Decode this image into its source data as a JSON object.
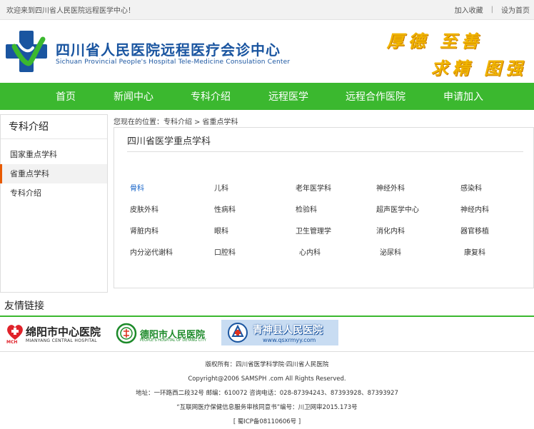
{
  "topbar": {
    "welcome": "欢迎来到四川省人民医院远程医学中心！",
    "favorite": "加入收藏",
    "separator": "|",
    "homepage": "设为首页"
  },
  "header": {
    "title_cn": "四川省人民医院远程医疗会诊中心",
    "title_en": "Sichuan Provincial People's Hospital Tele-Medicine Consulation Center",
    "slogan_line1": "厚德 至善",
    "slogan_line2": "求精 图强",
    "colors": {
      "brand_blue": "#1a55a0",
      "brand_green": "#3bb82f",
      "slogan_gold": "#f0b400"
    }
  },
  "nav": {
    "items": [
      "首页",
      "新闻中心",
      "专科介绍",
      "远程医学",
      "远程合作医院",
      "申请加入"
    ]
  },
  "sidebar": {
    "title": "专科介绍",
    "items": [
      "国家重点学科",
      "省重点学科",
      "专科介绍"
    ],
    "active_index": 1
  },
  "breadcrumb": {
    "prefix": "您现在的位置：",
    "level1": "专科介绍",
    "arrow": ">",
    "level2": "省重点学科"
  },
  "panel": {
    "title": "四川省医学重点学科",
    "departments": [
      [
        "骨科",
        "儿科",
        "老年医学科",
        "神经外科",
        "感染科"
      ],
      [
        "皮肤外科",
        "性病科",
        "检验科",
        "超声医学中心",
        "神经内科"
      ],
      [
        "肾脏内科",
        "眼科",
        "卫生管理学",
        "消化内科",
        "器官移植"
      ],
      [
        "内分泌代谢科",
        "口腔科",
        "心内科",
        "泌尿科",
        "康复科"
      ]
    ],
    "active_department": "骨科"
  },
  "friends": {
    "label": "友情链接",
    "links": [
      {
        "name": "绵阳市中心医院",
        "sub": "MIANYANG CENTRAL HOSPITAL",
        "mark": "MCH"
      },
      {
        "name": "德阳市人民医院",
        "sub": "PEOPLE'S HOSPITAL OF DEYANG CITY"
      },
      {
        "name": "青神县人民医院",
        "sub": "www.qsxrmyy.com"
      }
    ]
  },
  "footer": {
    "lines": [
      "版权所有：四川省医学科学院·四川省人民医院",
      "Copyright@2006 SAMSPH .com All Rights Reserved.",
      "地址：一环路西二段32号 邮编：610072 咨询电话：028-87394243、87393928、87393927",
      "“互联网医疗保健信息服务审核同意书”编号：川卫网审2015.173号",
      "[ 蜀ICP备08110606号 ]"
    ]
  }
}
